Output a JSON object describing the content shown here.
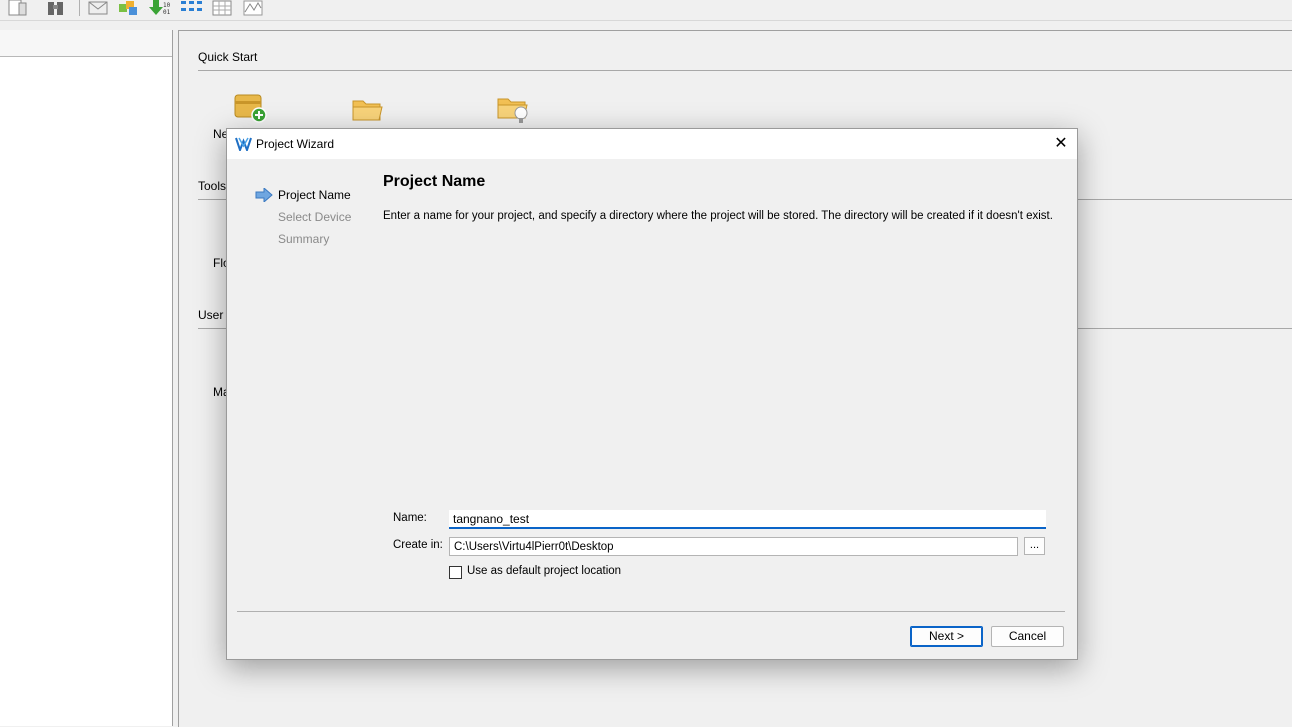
{
  "main": {
    "quick_start_title": "Quick Start",
    "quick_start_items": [
      {
        "label": "Ne"
      }
    ],
    "tools_title": "Tools",
    "tools_items": [
      {
        "label": "Flo"
      }
    ],
    "user_title": "User M",
    "user_items": [
      {
        "label": "Ma"
      }
    ]
  },
  "dialog": {
    "title": "Project Wizard",
    "steps": [
      {
        "label": "Project Name",
        "active": true
      },
      {
        "label": "Select Device",
        "active": false
      },
      {
        "label": "Summary",
        "active": false
      }
    ],
    "heading": "Project Name",
    "description": "Enter a name for your project, and specify a directory where the project will be stored. The directory will be created if it doesn't exist.",
    "name_label": "Name:",
    "name_value": "tangnano_test",
    "location_label": "Create in:",
    "location_value": "C:\\Users\\Virtu4lPierr0t\\Desktop",
    "browse_label": "...",
    "default_checkbox_label": "Use as default project location",
    "next_label": "Next >",
    "cancel_label": "Cancel"
  },
  "colors": {
    "accent": "#0a64c8",
    "background": "#f0f0f0"
  }
}
